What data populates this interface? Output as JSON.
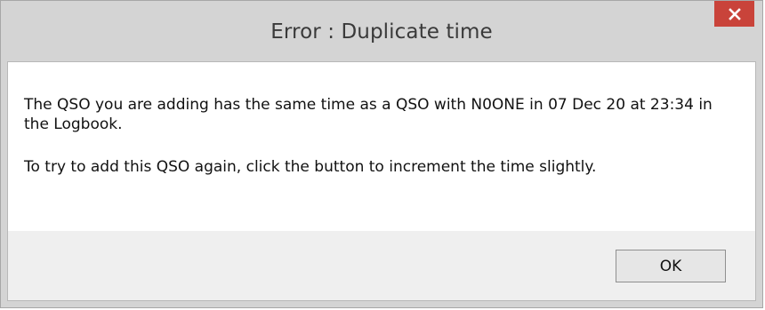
{
  "window": {
    "title": "Error : Duplicate time"
  },
  "dialog": {
    "message_line1": "The QSO you are adding has the same time as a QSO with N0ONE in 07 Dec 20 at 23:34 in the Logbook.",
    "message_line2": "To try to add this QSO again, click the button to increment the time slightly.",
    "ok_label": "OK"
  },
  "icons": {
    "close": "close-icon"
  },
  "colors": {
    "titlebar": "#d4d4d4",
    "close_button": "#c9433a",
    "client_background": "#ffffff",
    "footer_background": "#efefef"
  }
}
